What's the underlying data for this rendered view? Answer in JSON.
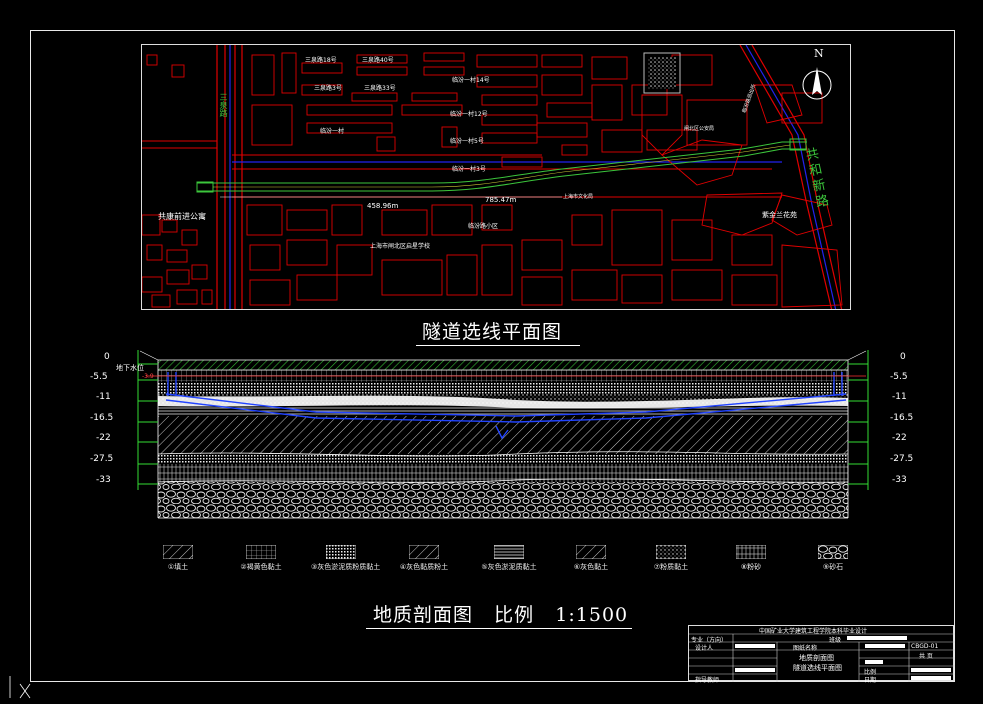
{
  "plan": {
    "title": "隧道选线平面图",
    "labels": {
      "road_left": "三泉路",
      "road_right": "共和新路",
      "north": "N",
      "dist1": "458.96m",
      "dist2": "785.47m",
      "apt": "共康前进公寓",
      "school": "上海市闸北区启星学校",
      "garden": "紫金兰花苑",
      "lianbei": "临汾路小区",
      "a1": "三泉路18号",
      "a2": "三泉路40号",
      "a3": "三泉路3号",
      "a4": "三泉路33号",
      "a5": "临汾一村14号",
      "a6": "临汾一村12号",
      "a7": "临汾一村",
      "a8": "临汾一村5号",
      "a9": "临汾一村3号",
      "a10": "上海市文化局",
      "a11": "闸北区公安局",
      "a12": "临汾路派出所"
    }
  },
  "section": {
    "title": "地质剖面图",
    "scale_label": "比例",
    "scale": "1:1500",
    "water_label": "地下水位",
    "water_value": "-3.9",
    "depth_ticks": [
      "0",
      "-5.5",
      "-11",
      "-16.5",
      "-22",
      "-27.5",
      "-33"
    ]
  },
  "legend": [
    "①填土",
    "②褐黄色黏土",
    "③灰色淤泥质粉质黏土",
    "④灰色黏质粉土",
    "⑤灰色淤泥质黏土",
    "⑥灰色黏土",
    "⑦粉质黏土",
    "⑧粉砂",
    "⑨砂石"
  ],
  "titleblock": {
    "school": "中国矿业大学建筑工程学院本科毕业设计",
    "major": "专业（方向）",
    "drawing_name": "图纸名称",
    "designer": "设计人",
    "advisor": "指导教师",
    "drawing_title_1": "地质剖面图",
    "drawing_title_2": "隧道选线平面图",
    "scale": "比例",
    "date": "日期",
    "number": "CBGD-01",
    "grade": "共 页",
    "class": "班级"
  },
  "colors": {
    "frame": "#e8e8e8",
    "building": "#e00000",
    "road_blue": "#2222ee",
    "tunnel_green": "#3cc63c",
    "tick_green": "#33dd33"
  }
}
